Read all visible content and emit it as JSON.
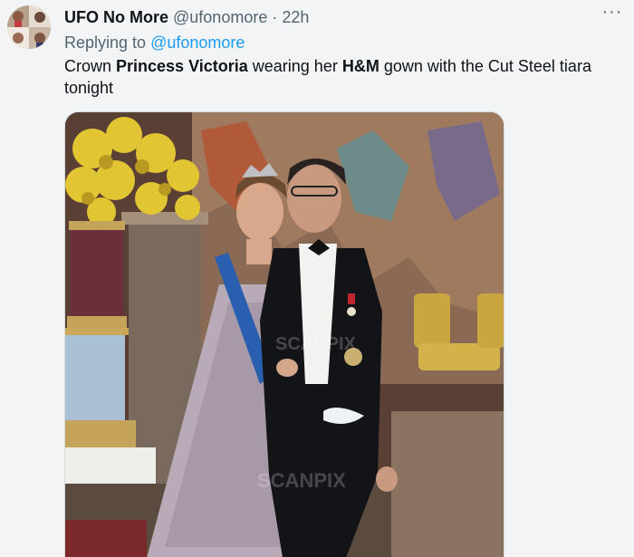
{
  "tweet": {
    "author_name": "UFO No More",
    "author_handle": "@ufonomore",
    "separator": "·",
    "time": "22h",
    "more_label": "···",
    "replying_prefix": "Replying to ",
    "replying_handle": "@ufonomore",
    "text_parts": [
      "Crown ",
      "Princess Victoria",
      " wearing her ",
      "H&M",
      " gown with the Cut Steel tiara tonight"
    ]
  },
  "media": {
    "watermark": "SCANPIX",
    "icon": "photo"
  },
  "colors": {
    "link": "#1d9bf0",
    "secondary_text": "#536471",
    "primary_text": "#0f1419",
    "background": "#f2f4f5"
  }
}
